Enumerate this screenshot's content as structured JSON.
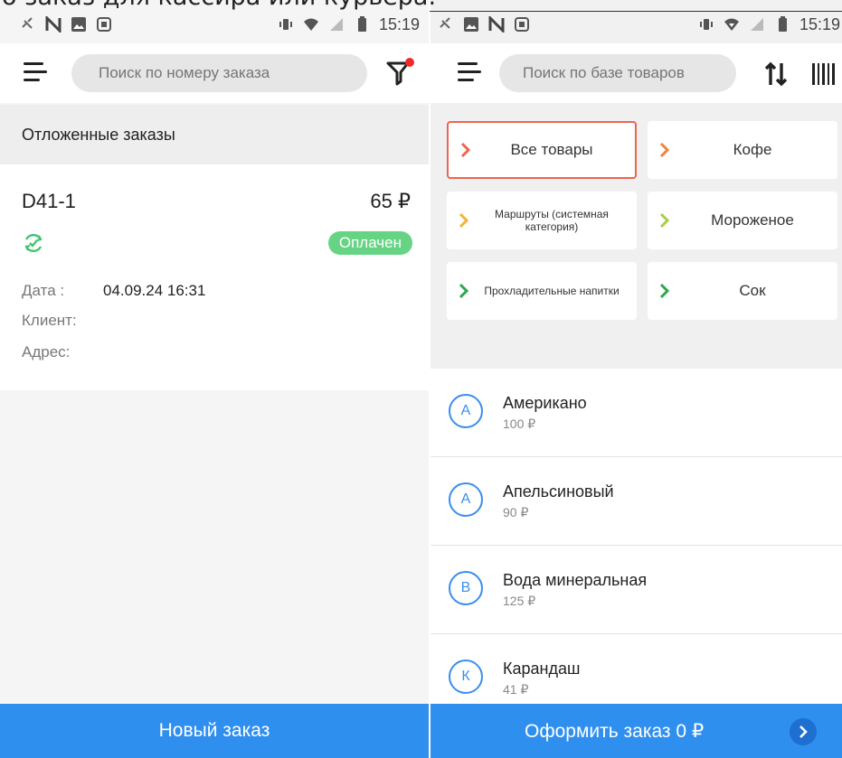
{
  "caption": "о заказ для кассира или курьера.",
  "status_bar": {
    "left_time": "15:19",
    "right_time": "15:19"
  },
  "left": {
    "search_placeholder": "Поиск по номеру заказа",
    "section_title": "Отложенные заказы",
    "order": {
      "id": "D41-1",
      "sum": "65 ₽",
      "status": "Оплачен",
      "date_label": "Дата :",
      "date_value": "04.09.24 16:31",
      "client_label": "Клиент:",
      "address_label": "Адрес:"
    },
    "bottom_button": "Новый заказ"
  },
  "right": {
    "search_placeholder": "Поиск по базе товаров",
    "categories": [
      {
        "label": "Все товары",
        "chevron_color": "#ef6450",
        "selected": true
      },
      {
        "label": "Кофе",
        "chevron_color": "#f2813f",
        "selected": false
      },
      {
        "label": "Маршруты (системная категория)",
        "chevron_color": "#f2b33a",
        "selected": false
      },
      {
        "label": "Мороженое",
        "chevron_color": "#a6cf46",
        "selected": false
      },
      {
        "label": "Прохладительные напитки",
        "chevron_color": "#2ea84a",
        "selected": false
      },
      {
        "label": "Сок",
        "chevron_color": "#2ea84a",
        "selected": false
      }
    ],
    "pager": {
      "pages": 3,
      "active": 2
    },
    "products": [
      {
        "letter": "А",
        "name": "Американо",
        "price": "100 ₽"
      },
      {
        "letter": "А",
        "name": "Апельсиновый",
        "price": "90 ₽"
      },
      {
        "letter": "В",
        "name": "Вода минеральная",
        "price": "125 ₽"
      },
      {
        "letter": "К",
        "name": "Карандаш",
        "price": "41 ₽"
      }
    ],
    "bottom_button": "Оформить заказ 0 ₽"
  },
  "colors": {
    "accent": "#2f8fef",
    "paid_badge": "#66d484",
    "selected_border": "#ef6450",
    "avatar": "#3a8ef0"
  }
}
